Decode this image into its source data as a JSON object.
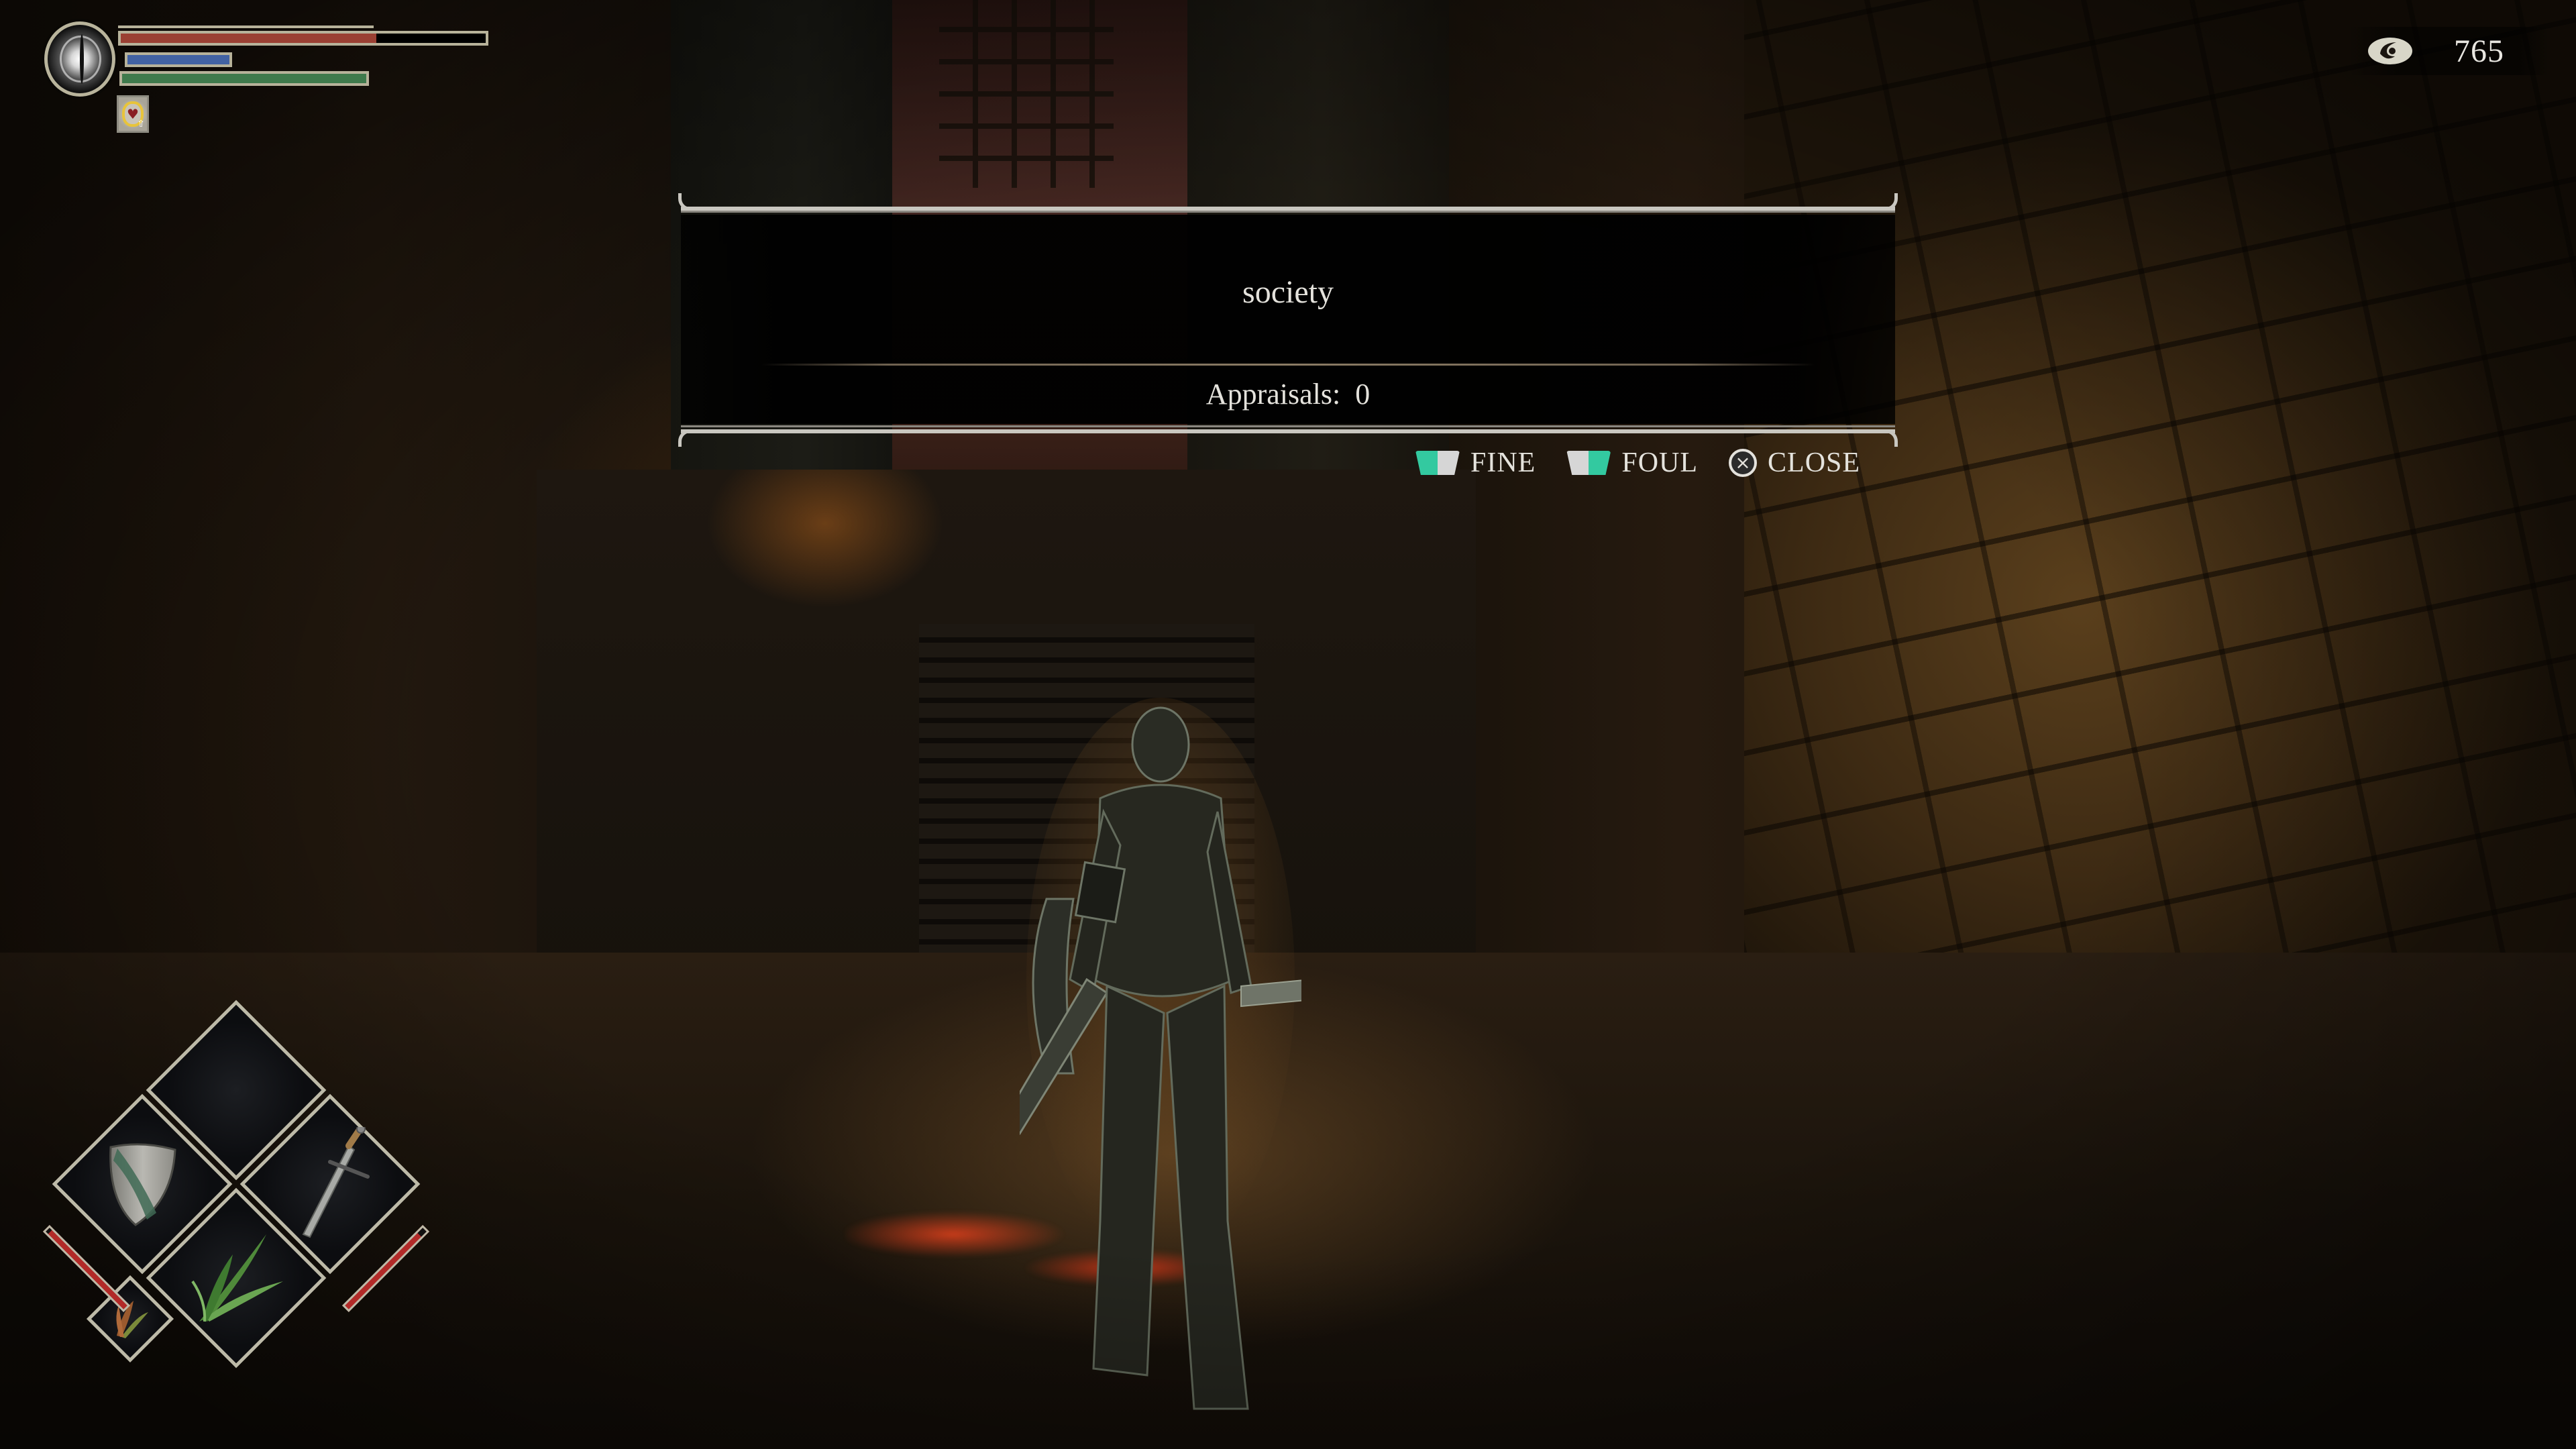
{
  "hud": {
    "emblem_icon": "soul-form-eye-icon",
    "hp": {
      "fraction": 0.7,
      "color": "#9a4033",
      "max_cap_fraction": 0.7
    },
    "mp": {
      "fraction": 1.0,
      "color": "#4262a3"
    },
    "stamina": {
      "fraction": 1.0,
      "color": "#3f7a4c"
    },
    "buffs": [
      {
        "icon": "max-hp-up-heart-icon"
      }
    ]
  },
  "souls": {
    "icon": "souls-swirl-icon",
    "value": "765"
  },
  "dialog": {
    "message": "society",
    "appraisals_label": "Appraisals:",
    "appraisals_count": "0"
  },
  "prompts": [
    {
      "id": "fine",
      "icon": "touchpad-left-icon",
      "label": "FINE"
    },
    {
      "id": "foul",
      "icon": "touchpad-right-icon",
      "label": "FOUL"
    },
    {
      "id": "close",
      "icon": "cross-button-icon",
      "label": "CLOSE"
    }
  ],
  "prompt_colors": {
    "active": "#33c9a0",
    "inactive": "#d6d6d6"
  },
  "equipment": {
    "top": {
      "item": "empty",
      "icon": ""
    },
    "left": {
      "item": "shield",
      "icon": "heater-shield-icon",
      "durability": 0.97
    },
    "right": {
      "item": "sword",
      "icon": "longsword-icon",
      "durability": 0.93
    },
    "bottom": {
      "item": "herb",
      "icon": "herb-bundle-icon"
    },
    "sub": {
      "item": "herb",
      "icon": "red-herb-bundle-icon"
    }
  },
  "scene": {
    "description": "soul-form character standing in a stone alley with glowing embers",
    "ember_color": "#ff4a22"
  }
}
